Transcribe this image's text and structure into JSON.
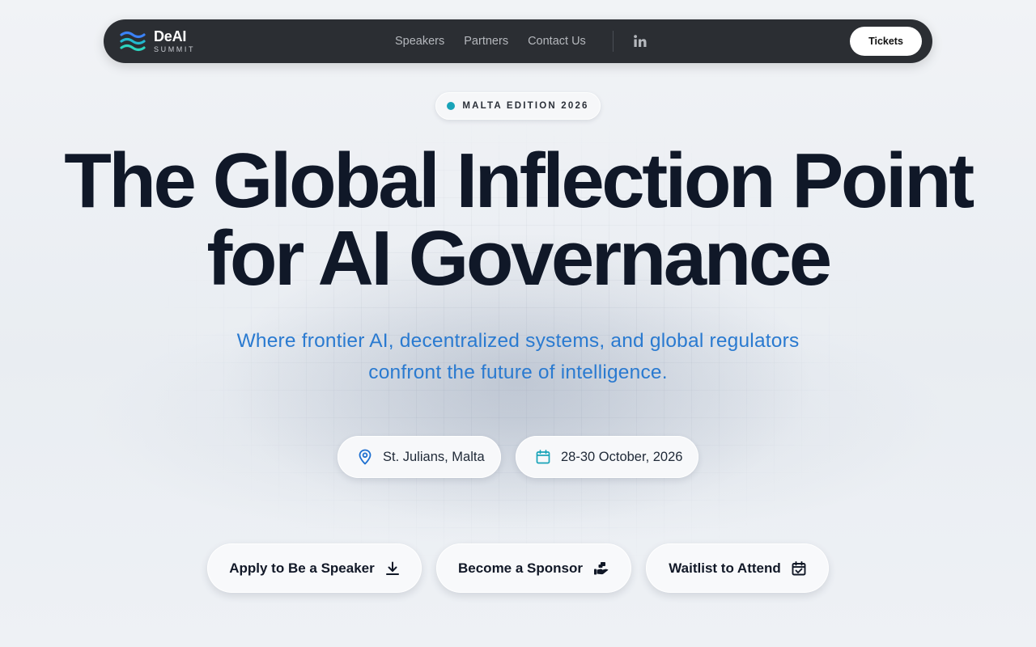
{
  "nav": {
    "logo_title": "DeAI",
    "logo_subtitle": "SUMMIT",
    "links": [
      "Speakers",
      "Partners",
      "Contact Us"
    ],
    "social_icon": "linkedin-icon",
    "tickets_label": "Tickets"
  },
  "hero": {
    "badge": "MALTA EDITION 2026",
    "headline_line1": "The Global Inflection Point",
    "headline_line2": "for AI Governance",
    "subline_line1": "Where frontier AI, decentralized systems, and global regulators",
    "subline_line2": "confront the future of intelligence.",
    "location": "St. Julians, Malta",
    "location_icon": "map-pin-icon",
    "dates": "28-30 October, 2026",
    "dates_icon": "calendar-icon"
  },
  "cta": {
    "speaker_label": "Apply to Be a Speaker",
    "speaker_icon": "download-icon",
    "sponsor_label": "Become a Sponsor",
    "sponsor_icon": "hand-coins-icon",
    "waitlist_label": "Waitlist to Attend",
    "waitlist_icon": "calendar-check-icon"
  },
  "colors": {
    "nav_bg": "#2b2e33",
    "headline": "#101828",
    "subline": "#2a7ad0",
    "accent_teal": "#18a3b8",
    "logo_blue": "#3b82f6"
  }
}
